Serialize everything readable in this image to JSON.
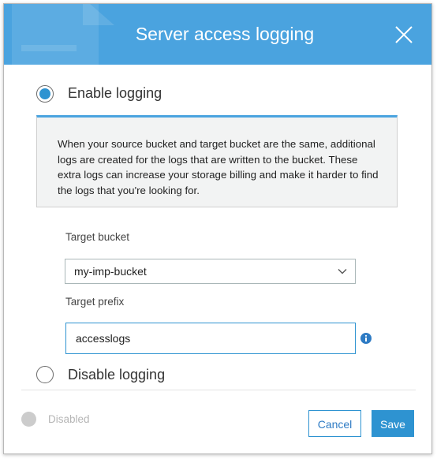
{
  "dialog": {
    "title": "Server access logging",
    "close_icon": "close-icon",
    "accent_color": "#4aa3df"
  },
  "options": {
    "enable_label": "Enable logging",
    "enable_selected": true,
    "disable_label": "Disable logging",
    "disable_selected": false
  },
  "warning": {
    "text": "When your source bucket and target bucket are the same, additional logs are created for the logs that are written to the bucket. These extra logs can increase your storage billing and make it harder to find the logs that you're looking for."
  },
  "target_bucket": {
    "label": "Target bucket",
    "value": "my-imp-bucket",
    "icon": "chevron-down-icon"
  },
  "target_prefix": {
    "label": "Target prefix",
    "value": "accesslogs",
    "info_icon": "info-icon"
  },
  "footer": {
    "status_text": "Disabled",
    "cancel_label": "Cancel",
    "save_label": "Save"
  }
}
